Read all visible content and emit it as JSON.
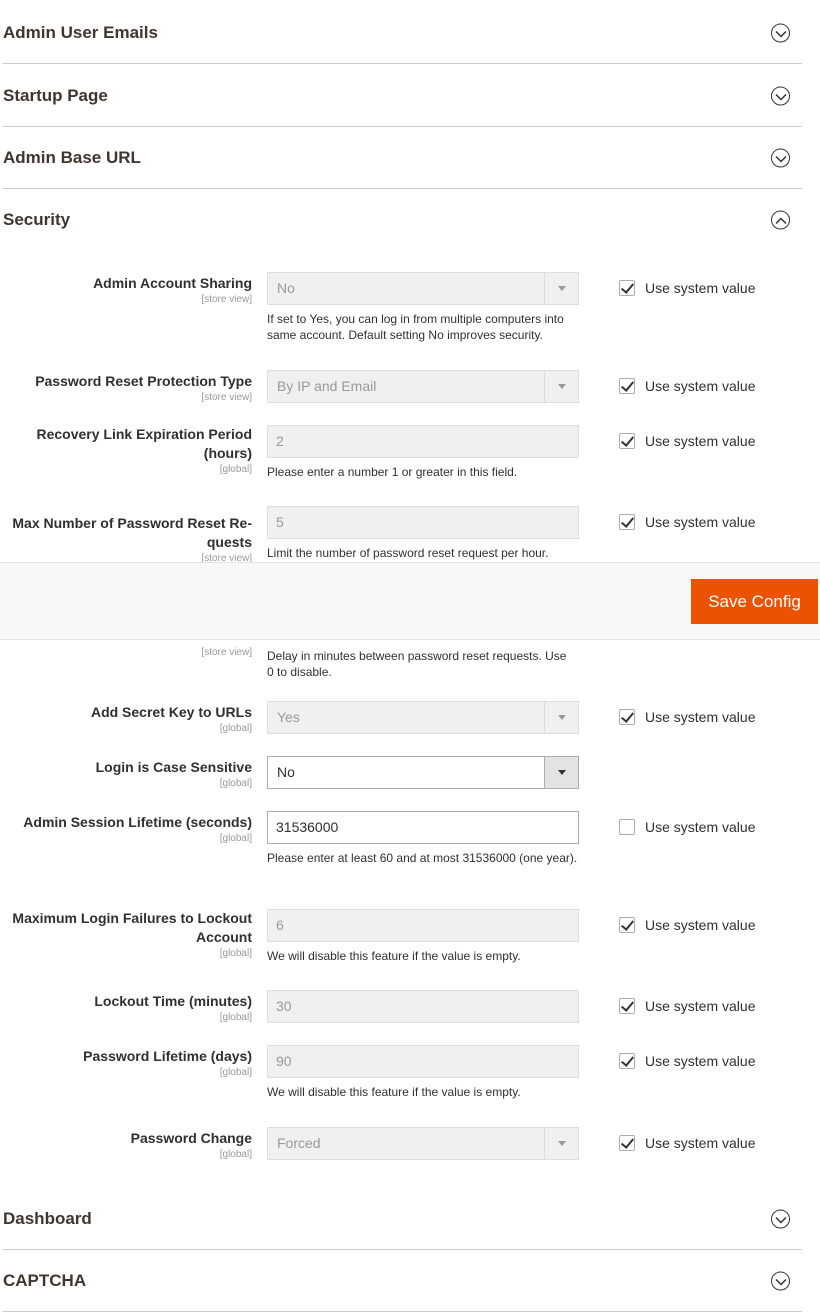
{
  "sections_top": [
    {
      "title": "Admin User Emails"
    },
    {
      "title": "Startup Page"
    },
    {
      "title": "Admin Base URL"
    },
    {
      "title": "Security"
    }
  ],
  "sections_bottom": [
    {
      "title": "Dashboard"
    },
    {
      "title": "CAPTCHA"
    }
  ],
  "use_system_label": "Use system value",
  "fields": [
    {
      "label": "Admin Account Sharing",
      "scope": "[store view]",
      "value": "No",
      "type": "select",
      "disabled": true,
      "use_system": true,
      "note": "If set to Yes, you can log in from multiple computers into same account. Default setting No improves security."
    },
    {
      "label": "Password Reset Protection Type",
      "scope": "[store view]",
      "value": "By IP and Email",
      "type": "select",
      "disabled": true,
      "use_system": true
    },
    {
      "label": "Recovery Link Expiration Period (hours)",
      "scope": "[global]",
      "value": "2",
      "type": "text",
      "disabled": true,
      "use_system": true,
      "note": "Please enter a number 1 or greater in this field."
    },
    {
      "label": "Max Number of Password Reset Re-quests",
      "scope": "[store view]",
      "value": "5",
      "type": "text",
      "disabled": true,
      "use_system": true,
      "note": "Limit the number of password reset request per hour."
    },
    {
      "scope": "[store view]",
      "note": "Delay in minutes between password reset requests. Use 0 to disable."
    },
    {
      "label": "Add Secret Key to URLs",
      "scope": "[global]",
      "value": "Yes",
      "type": "select",
      "disabled": true,
      "use_system": true
    },
    {
      "label": "Login is Case Sensitive",
      "scope": "[global]",
      "value": "No",
      "type": "select",
      "disabled": false
    },
    {
      "label": "Admin Session Lifetime (seconds)",
      "scope": "[global]",
      "value": "31536000",
      "type": "text",
      "disabled": false,
      "use_system": false,
      "note": "Please enter at least 60 and at most 31536000 (one year)."
    },
    {
      "label": "Maximum Login Failures to Lockout Account",
      "scope": "[global]",
      "value": "6",
      "type": "text",
      "disabled": true,
      "use_system": true,
      "note": "We will disable this feature if the value is empty."
    },
    {
      "label": "Lockout Time (minutes)",
      "scope": "[global]",
      "value": "30",
      "type": "text",
      "disabled": true,
      "use_system": true
    },
    {
      "label": "Password Lifetime (days)",
      "scope": "[global]",
      "value": "90",
      "type": "text",
      "disabled": true,
      "use_system": true,
      "note": "We will disable this feature if the value is empty."
    },
    {
      "label": "Password Change",
      "scope": "[global]",
      "value": "Forced",
      "type": "select",
      "disabled": true,
      "use_system": true
    }
  ],
  "toolbar": {
    "save_label": "Save Config",
    "accent": "#eb5202"
  }
}
